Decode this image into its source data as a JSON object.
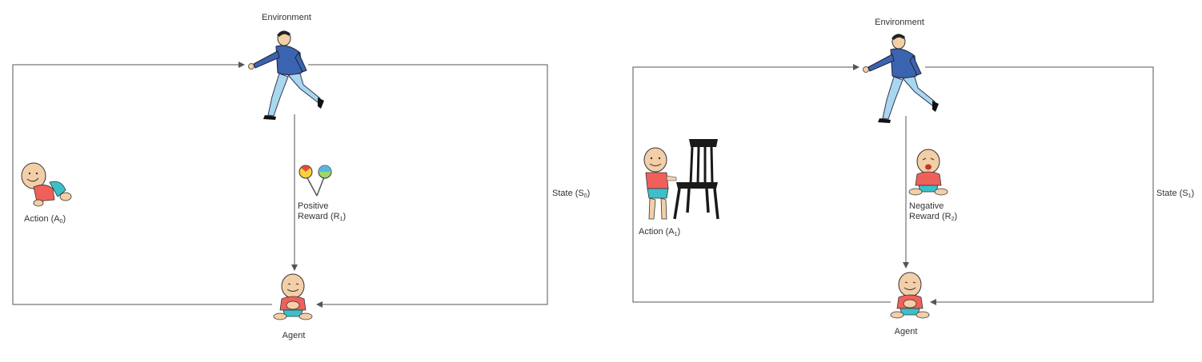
{
  "panels": [
    {
      "environment_label": "Environment",
      "agent_label": "Agent",
      "action_label": "Action (A",
      "action_sub": "0",
      "reward_line1": "Positive",
      "reward_line2": "Reward (R",
      "reward_sub": "1",
      "state_label": "State (S",
      "state_sub": "0",
      "action_icon": "crawling-baby-icon",
      "reward_icon": "lollipops-icon"
    },
    {
      "environment_label": "Environment",
      "agent_label": "Agent",
      "action_label": "Action (A",
      "action_sub": "1",
      "reward_line1": "Negative",
      "reward_line2": "Reward (R",
      "reward_sub": "2",
      "state_label": "State (S",
      "state_sub": "1",
      "action_icon": "standing-baby-with-chair-icon",
      "reward_icon": "crying-baby-icon"
    }
  ],
  "colors": {
    "line": "#555555",
    "shirt_blue": "#3a64b0",
    "pants_light_blue": "#a8d8ee",
    "baby_shirt": "#f0605a",
    "baby_diaper": "#3cc0c8",
    "skin": "#f3cfa8"
  }
}
